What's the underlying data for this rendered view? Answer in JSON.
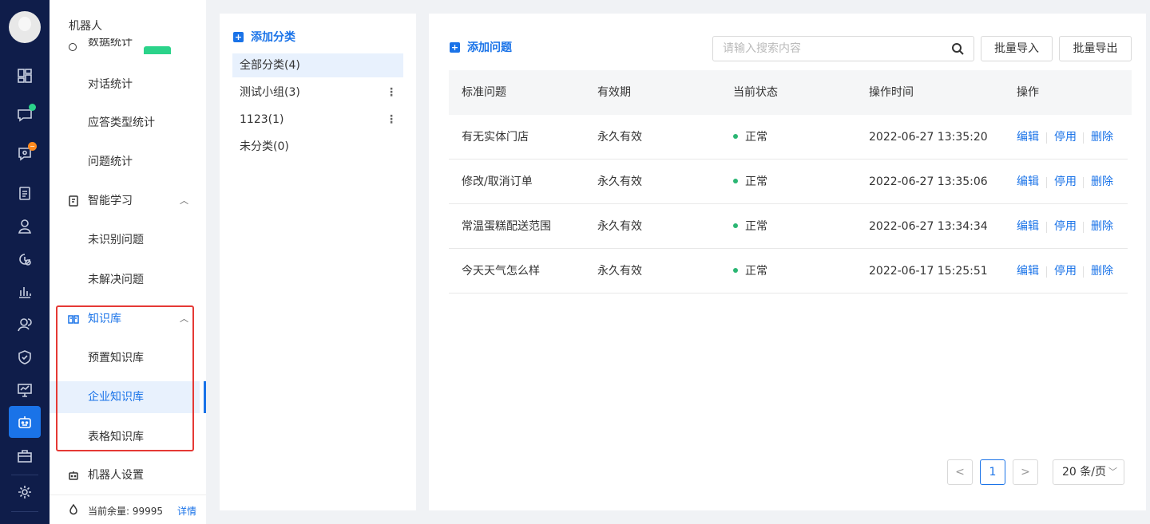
{
  "rail": {
    "icons": [
      "dashboard-icon",
      "chat-icon",
      "call-icon",
      "clipboard-icon",
      "user-icon",
      "history-icon",
      "bar-chart-icon",
      "team-icon",
      "shield-icon",
      "monitor-icon",
      "robot-icon",
      "toolbox-icon",
      "settings-icon"
    ]
  },
  "menu": {
    "title": "机器人",
    "clipped_label": "数据统计",
    "items": {
      "dialog_stats": "对话统计",
      "answer_type_stats": "应答类型统计",
      "question_stats": "问题统计",
      "smart_learning": "智能学习",
      "unrecognized": "未识别问题",
      "unresolved": "未解决问题",
      "knowledge_base": "知识库",
      "preset_kb": "预置知识库",
      "enterprise_kb": "企业知识库",
      "table_kb": "表格知识库",
      "robot_settings": "机器人设置"
    },
    "balance_label": "当前余量:",
    "balance_value": "99995",
    "balance_link": "详情"
  },
  "categories": {
    "add_label": "添加分类",
    "items": [
      {
        "label": "全部分类(4)",
        "more": ""
      },
      {
        "label": "测试小组(3)",
        "more": "⋮"
      },
      {
        "label": "1123(1)",
        "more": "⋮"
      },
      {
        "label": "未分类(0)",
        "more": ""
      }
    ]
  },
  "main": {
    "add_label": "添加问题",
    "search_placeholder": "请输入搜索内容",
    "import_label": "批量导入",
    "export_label": "批量导出",
    "columns": [
      "标准问题",
      "有效期",
      "当前状态",
      "操作时间",
      "操作"
    ],
    "rows": [
      {
        "question": "有无实体门店",
        "validity": "永久有效",
        "status": "正常",
        "time": "2022-06-27 13:35:20"
      },
      {
        "question": "修改/取消订单",
        "validity": "永久有效",
        "status": "正常",
        "time": "2022-06-27 13:35:06"
      },
      {
        "question": "常温蛋糕配送范围",
        "validity": "永久有效",
        "status": "正常",
        "time": "2022-06-27 13:34:34"
      },
      {
        "question": "今天天气怎么样",
        "validity": "永久有效",
        "status": "正常",
        "time": "2022-06-17 15:25:51"
      }
    ],
    "actions": {
      "edit": "编辑",
      "disable": "停用",
      "delete": "删除"
    },
    "pager": {
      "prev": "<",
      "current": "1",
      "next": ">",
      "page_size": "20 条/页"
    }
  },
  "colors": {
    "accent": "#1a73e8",
    "rail_bg": "#0f1d4a",
    "status_ok": "#2bb673",
    "highlight_box": "#e53935"
  }
}
